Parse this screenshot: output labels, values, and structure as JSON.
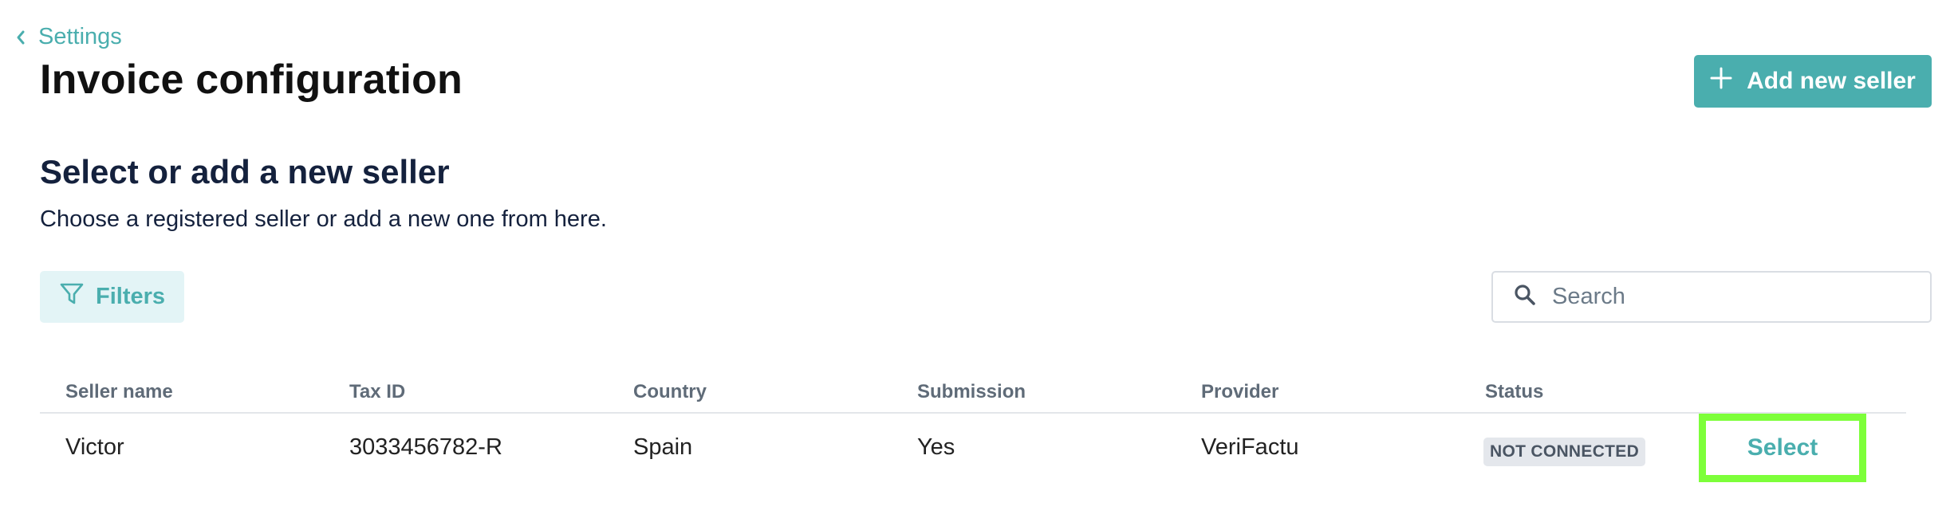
{
  "nav": {
    "back_label": "Settings"
  },
  "page": {
    "title": "Invoice configuration"
  },
  "actions": {
    "add_seller_label": "Add new seller"
  },
  "section": {
    "title": "Select or add a new seller",
    "subtitle": "Choose a registered seller or add a new one from here."
  },
  "toolbar": {
    "filters_label": "Filters",
    "search_placeholder": "Search"
  },
  "table": {
    "headers": {
      "seller_name": "Seller name",
      "tax_id": "Tax ID",
      "country": "Country",
      "submission": "Submission",
      "provider": "Provider",
      "status": "Status"
    },
    "rows": [
      {
        "seller_name": "Victor",
        "tax_id": "3033456782-R",
        "country": "Spain",
        "submission": "Yes",
        "provider": "VeriFactu",
        "status": "NOT CONNECTED",
        "action_label": "Select"
      }
    ]
  },
  "colors": {
    "accent": "#4aaeae",
    "filters_bg": "#e3f4f6",
    "highlight": "#7dff3a",
    "badge_bg": "#e4e7ec"
  },
  "icons": {
    "back": "chevron-left-icon",
    "add": "plus-icon",
    "filters": "funnel-icon",
    "search": "search-icon"
  }
}
